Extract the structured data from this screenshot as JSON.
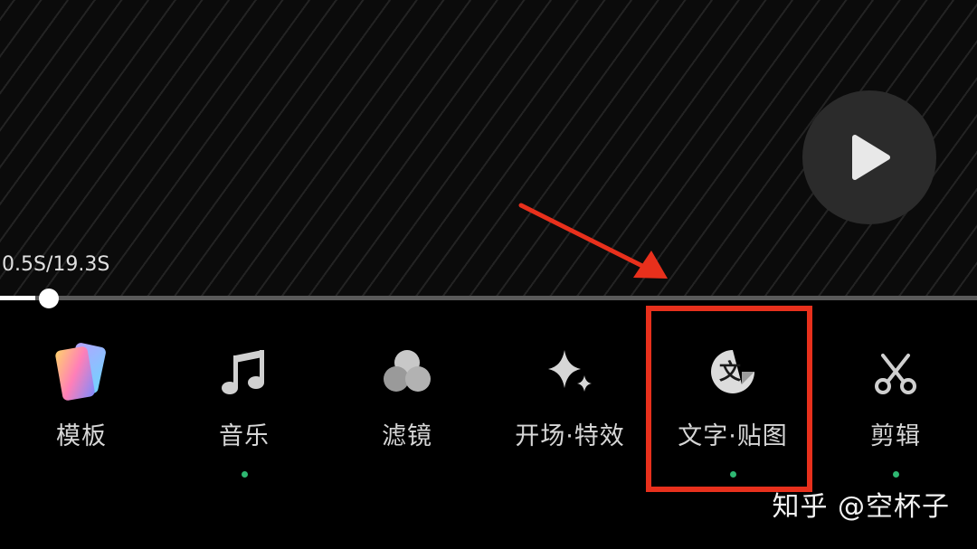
{
  "player": {
    "time_text": "0.5S/19.3S",
    "progress": 0.026
  },
  "toolbar": {
    "items": [
      {
        "label": "模板",
        "icon": "template-cards-icon",
        "dot": false
      },
      {
        "label": "音乐",
        "icon": "music-note-icon",
        "dot": true
      },
      {
        "label": "滤镜",
        "icon": "filter-circles-icon",
        "dot": false
      },
      {
        "label": "开场·特效",
        "icon": "sparkle-icon",
        "dot": false
      },
      {
        "label": "文字·贴图",
        "icon": "text-sticker-icon",
        "dot": true
      },
      {
        "label": "剪辑",
        "icon": "scissors-icon",
        "dot": true
      }
    ]
  },
  "annotation": {
    "highlight_color": "#e8301c",
    "target": "文字·贴图"
  },
  "watermark": "知乎 @空杯子",
  "colors": {
    "dot": "#2eb872",
    "background": "#000000"
  }
}
